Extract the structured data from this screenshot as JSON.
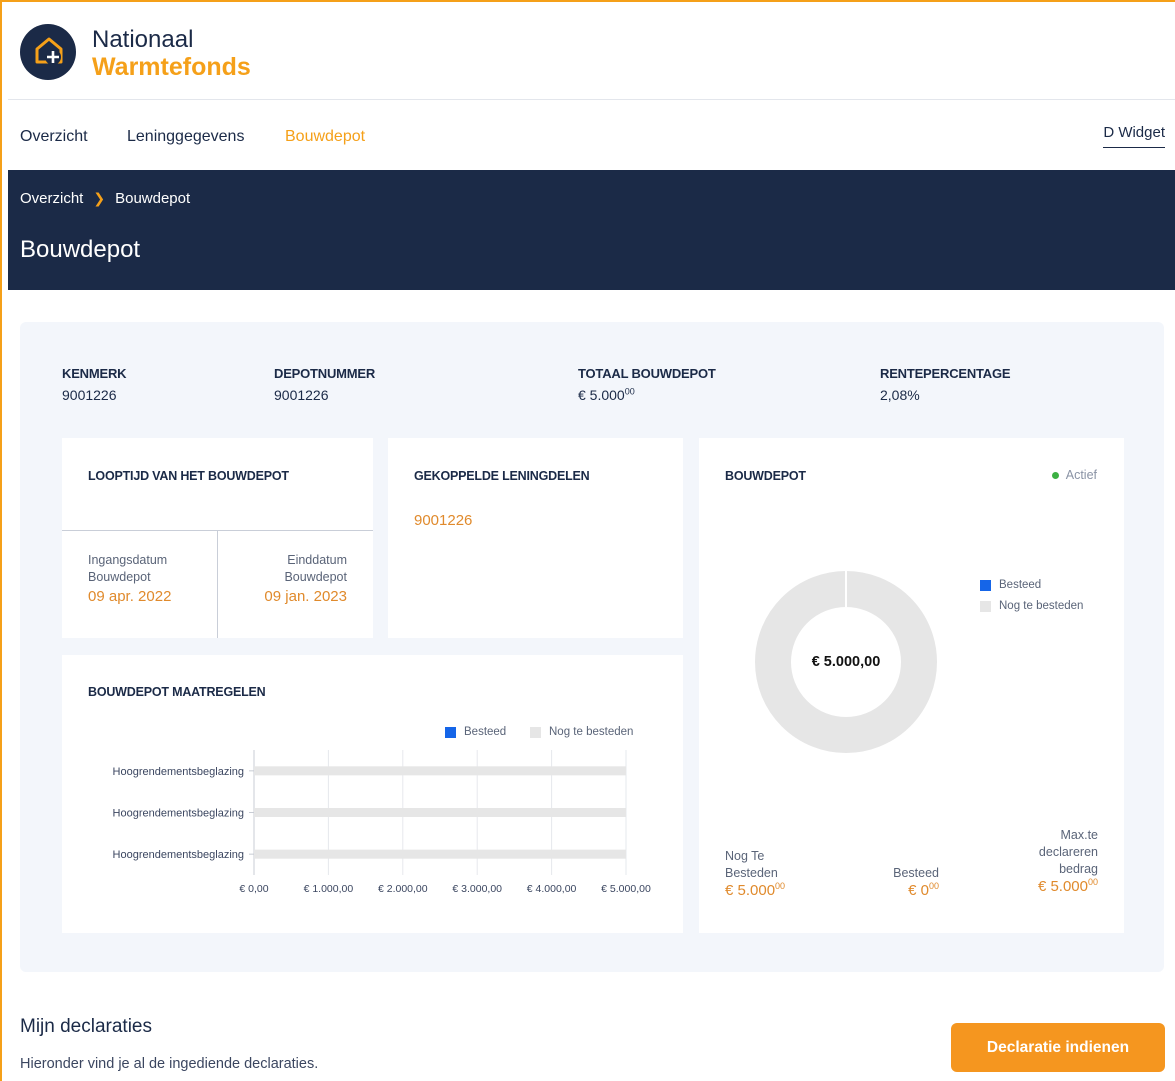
{
  "brand": {
    "line1": "Nationaal",
    "line2": "Warmtefonds"
  },
  "nav": {
    "items": [
      {
        "label": "Overzicht",
        "active": false
      },
      {
        "label": "Leninggegevens",
        "active": false
      },
      {
        "label": "Bouwdepot",
        "active": true
      }
    ],
    "user": "D Widget"
  },
  "breadcrumb": {
    "home": "Overzicht",
    "current": "Bouwdepot"
  },
  "page_title": "Bouwdepot",
  "summary": {
    "kenmerk": {
      "label": "KENMERK",
      "value": "9001226"
    },
    "depotnummer": {
      "label": "DEPOTNUMMER",
      "value": "9001226"
    },
    "totaal": {
      "label": "TOTAAL BOUWDEPOT",
      "value": "€ 5.000",
      "cents": "00"
    },
    "rente": {
      "label": "RENTEPERCENTAGE",
      "value": "2,08%"
    }
  },
  "looptijd": {
    "title": "LOOPTIJD VAN HET BOUWDEPOT",
    "start_label_1": "Ingangsdatum",
    "start_label_2": "Bouwdepot",
    "start_value": "09 apr. 2022",
    "end_label_1": "Einddatum",
    "end_label_2": "Bouwdepot",
    "end_value": "09 jan. 2023"
  },
  "gekoppeld": {
    "title": "GEKOPPELDE LENINGDELEN",
    "value": "9001226"
  },
  "donut": {
    "title": "BOUWDEPOT",
    "status": "Actief",
    "center_value": "€ 5.000,00",
    "legend": [
      "Besteed",
      "Nog te besteden"
    ],
    "stats": {
      "remaining_label_1": "Nog Te",
      "remaining_label_2": "Besteden",
      "remaining_value": "€ 5.000",
      "remaining_cents": "00",
      "spent_label": "Besteed",
      "spent_value": "€ 0",
      "spent_cents": "00",
      "max_label_1": "Max.te",
      "max_label_2": "declareren",
      "max_label_3": "bedrag",
      "max_value": "€ 5.000",
      "max_cents": "00"
    }
  },
  "maatregelen": {
    "title": "BOUWDEPOT MAATREGELEN"
  },
  "chart_data": {
    "type": "bar",
    "orientation": "horizontal",
    "stacked": true,
    "categories": [
      "Hoogrendementsbeglazing",
      "Hoogrendementsbeglazing",
      "Hoogrendementsbeglazing"
    ],
    "series": [
      {
        "name": "Besteed",
        "values": [
          0,
          0,
          0
        ],
        "color": "#1565e8"
      },
      {
        "name": "Nog te besteden",
        "values": [
          5000,
          5000,
          5000
        ],
        "color": "#e6e6e6"
      }
    ],
    "xlim": [
      0,
      5000
    ],
    "xticks": [
      0,
      1000,
      2000,
      3000,
      4000,
      5000
    ],
    "xtick_labels": [
      "€ 0,00",
      "€ 1.000,00",
      "€ 2.000,00",
      "€ 3.000,00",
      "€ 4.000,00",
      "€ 5.000,00"
    ],
    "grid": true,
    "legend": "top-right"
  },
  "declaraties": {
    "title": "Mijn declaraties",
    "subtitle": "Hieronder vind je al de ingediende declaraties.",
    "button": "Declaratie indienen"
  },
  "colors": {
    "navy": "#1b2a47",
    "orange": "#f5a019",
    "blue": "#1565e8",
    "grey": "#e6e6e6",
    "status_green": "#3cb043"
  }
}
